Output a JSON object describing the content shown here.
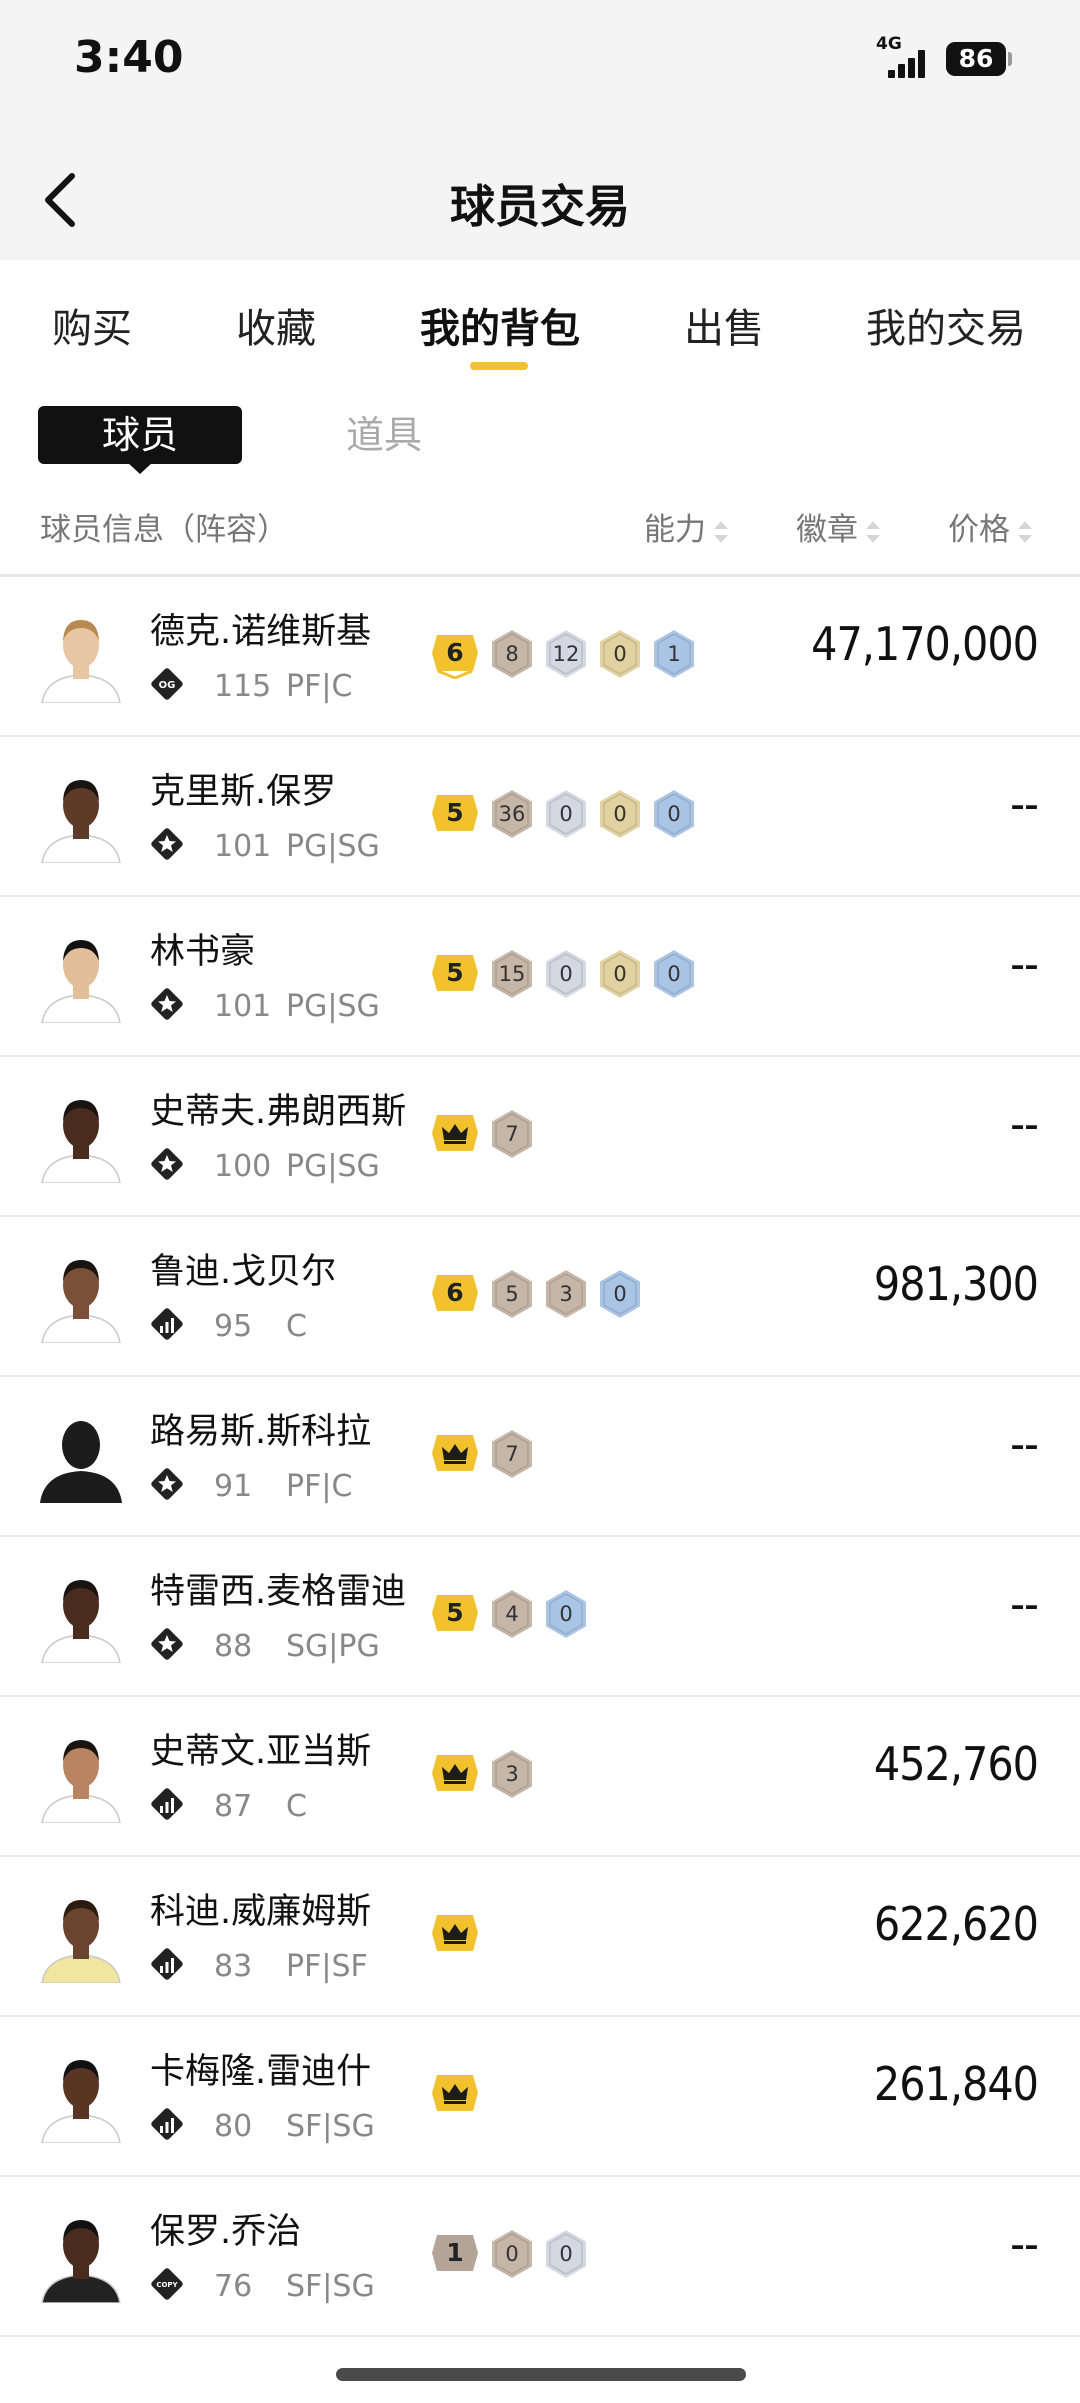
{
  "status": {
    "time": "3:40",
    "network": "4G",
    "battery": "86"
  },
  "nav": {
    "title": "球员交易"
  },
  "tabs": [
    {
      "label": "购买",
      "active": false
    },
    {
      "label": "收藏",
      "active": false
    },
    {
      "label": "我的背包",
      "active": true
    },
    {
      "label": "出售",
      "active": false
    },
    {
      "label": "我的交易",
      "active": false
    }
  ],
  "segments": {
    "active": "球员",
    "inactive": "道具"
  },
  "columns": {
    "info": "球员信息（阵容）",
    "ability": "能力",
    "badge": "徽章",
    "price": "价格"
  },
  "colors": {
    "accent": "#f2c12e",
    "badge_bronze": "#c6b6a7",
    "badge_silver": "#d3d8e2",
    "badge_gold": "#e2d2a0",
    "badge_blue": "#a9c4e4"
  },
  "players": [
    {
      "name": "德克.诺维斯基",
      "rating": "115",
      "position": "PF|C",
      "card": "og",
      "level": {
        "type": "number",
        "text": "6",
        "chevron": true
      },
      "badges": [
        {
          "tier": "bronze",
          "count": "8"
        },
        {
          "tier": "silver",
          "count": "12"
        },
        {
          "tier": "gold",
          "count": "0"
        },
        {
          "tier": "blue",
          "count": "1"
        }
      ],
      "price": "47,170,000",
      "skin": "#e8c6a3",
      "hair": "#b88a52",
      "shirt": "#ffffff",
      "silhouette": false
    },
    {
      "name": "克里斯.保罗",
      "rating": "101",
      "position": "PG|SG",
      "card": "star",
      "level": {
        "type": "number",
        "text": "5",
        "chevron": false
      },
      "badges": [
        {
          "tier": "bronze",
          "count": "36"
        },
        {
          "tier": "silver",
          "count": "0"
        },
        {
          "tier": "gold",
          "count": "0"
        },
        {
          "tier": "blue",
          "count": "0"
        }
      ],
      "price": "--",
      "skin": "#5e3b28",
      "hair": "#1a1410",
      "shirt": "#ffffff",
      "silhouette": false
    },
    {
      "name": "林书豪",
      "rating": "101",
      "position": "PG|SG",
      "card": "star",
      "level": {
        "type": "number",
        "text": "5",
        "chevron": false
      },
      "badges": [
        {
          "tier": "bronze",
          "count": "15"
        },
        {
          "tier": "silver",
          "count": "0"
        },
        {
          "tier": "gold",
          "count": "0"
        },
        {
          "tier": "blue",
          "count": "0"
        }
      ],
      "price": "--",
      "skin": "#e2bf98",
      "hair": "#111111",
      "shirt": "#ffffff",
      "silhouette": false
    },
    {
      "name": "史蒂夫.弗朗西斯",
      "rating": "100",
      "position": "PG|SG",
      "card": "star",
      "level": {
        "type": "crown"
      },
      "badges": [
        {
          "tier": "bronze",
          "count": "7"
        }
      ],
      "price": "--",
      "skin": "#4a2c1e",
      "hair": "#1a1410",
      "shirt": "#ffffff",
      "silhouette": false
    },
    {
      "name": "鲁迪.戈贝尔",
      "rating": "95",
      "position": "C",
      "card": "bars",
      "level": {
        "type": "number",
        "text": "6",
        "chevron": false
      },
      "badges": [
        {
          "tier": "bronze",
          "count": "5"
        },
        {
          "tier": "bronze",
          "count": "3"
        },
        {
          "tier": "blue",
          "count": "0"
        }
      ],
      "price": "981,300",
      "skin": "#7a5038",
      "hair": "#1a1410",
      "shirt": "#ffffff",
      "silhouette": false
    },
    {
      "name": "路易斯.斯科拉",
      "rating": "91",
      "position": "PF|C",
      "card": "star",
      "level": {
        "type": "crown"
      },
      "badges": [
        {
          "tier": "bronze",
          "count": "7"
        }
      ],
      "price": "--",
      "skin": "#1c1c1c",
      "hair": "#1c1c1c",
      "shirt": "#1c1c1c",
      "silhouette": true
    },
    {
      "name": "特雷西.麦格雷迪",
      "rating": "88",
      "position": "SG|PG",
      "card": "star",
      "level": {
        "type": "number",
        "text": "5",
        "chevron": false
      },
      "badges": [
        {
          "tier": "bronze",
          "count": "4"
        },
        {
          "tier": "blue",
          "count": "0"
        }
      ],
      "price": "--",
      "skin": "#4a2c1e",
      "hair": "#1a1410",
      "shirt": "#ffffff",
      "silhouette": false
    },
    {
      "name": "史蒂文.亚当斯",
      "rating": "87",
      "position": "C",
      "card": "bars",
      "level": {
        "type": "crown"
      },
      "badges": [
        {
          "tier": "bronze",
          "count": "3"
        }
      ],
      "price": "452,760",
      "skin": "#b98462",
      "hair": "#1a1410",
      "shirt": "#ffffff",
      "silhouette": false
    },
    {
      "name": "科迪.威廉姆斯",
      "rating": "83",
      "position": "PF|SF",
      "card": "bars",
      "level": {
        "type": "crown"
      },
      "badges": [],
      "price": "622,620",
      "skin": "#6b442f",
      "hair": "#2b1c12",
      "shirt": "#f0e6a0",
      "silhouette": false
    },
    {
      "name": "卡梅隆.雷迪什",
      "rating": "80",
      "position": "SF|SG",
      "card": "bars",
      "level": {
        "type": "crown"
      },
      "badges": [],
      "price": "261,840",
      "skin": "#5a3524",
      "hair": "#111111",
      "shirt": "#ffffff",
      "silhouette": false
    },
    {
      "name": "保罗.乔治",
      "rating": "76",
      "position": "SF|SG",
      "card": "copy",
      "level": {
        "type": "number",
        "text": "1",
        "chevron": false,
        "dark": true
      },
      "badges": [
        {
          "tier": "bronze",
          "count": "0"
        },
        {
          "tier": "silver",
          "count": "0"
        }
      ],
      "price": "--",
      "skin": "#4a2c1e",
      "hair": "#111111",
      "shirt": "#222222",
      "silhouette": false
    }
  ]
}
